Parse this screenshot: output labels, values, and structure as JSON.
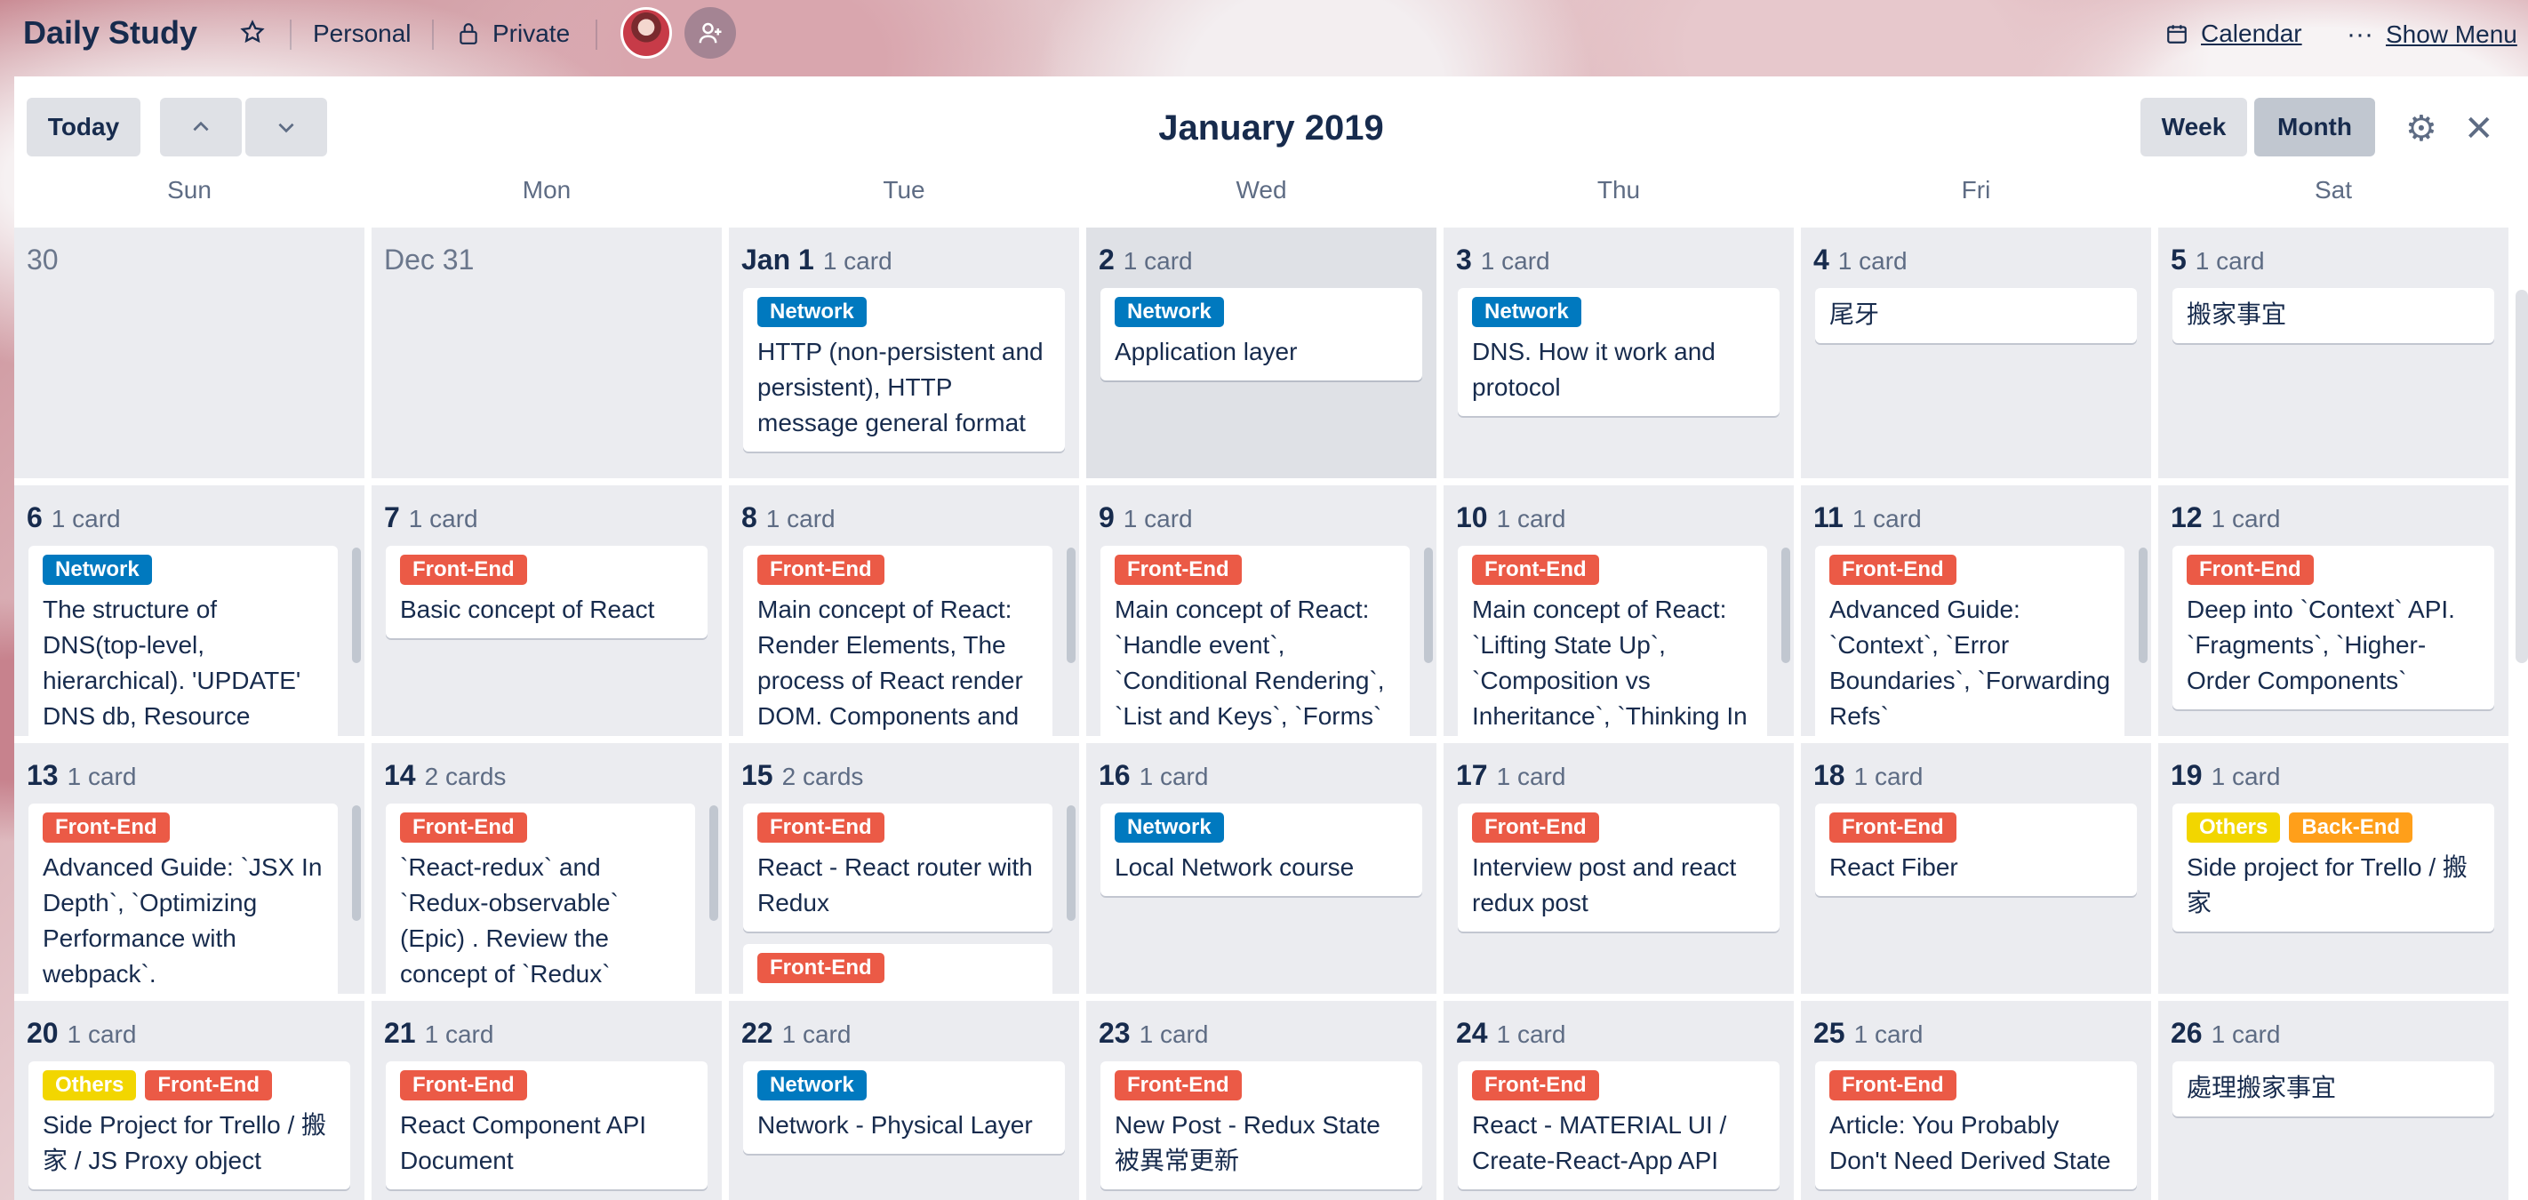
{
  "header": {
    "board_title": "Daily Study",
    "team": "Personal",
    "visibility": "Private",
    "calendar_link": "Calendar",
    "show_menu": "Show Menu"
  },
  "toolbar": {
    "today": "Today",
    "up": "⌃",
    "down": "⌄",
    "month_title": "January 2019",
    "week": "Week",
    "month": "Month",
    "settings": "⚙",
    "close": "✕"
  },
  "weekdays": [
    "Sun",
    "Mon",
    "Tue",
    "Wed",
    "Thu",
    "Fri",
    "Sat"
  ],
  "label_colors": {
    "Network": "#0079bf",
    "Front-End": "#eb5a46",
    "Others": "#f2d600",
    "Back-End": "#ff9f1a"
  },
  "weeks": [
    [
      {
        "num": "30",
        "count": "",
        "dim": true,
        "cards": []
      },
      {
        "num": "Dec 31",
        "count": "",
        "dim": true,
        "cards": []
      },
      {
        "num": "Jan 1",
        "count": "1 card",
        "cards": [
          {
            "labels": [
              "Network"
            ],
            "title": "HTTP (non-persistent and persistent), HTTP message general format"
          }
        ]
      },
      {
        "num": "2",
        "count": "1 card",
        "today": true,
        "cards": [
          {
            "labels": [
              "Network"
            ],
            "title": "Application layer"
          }
        ]
      },
      {
        "num": "3",
        "count": "1 card",
        "cards": [
          {
            "labels": [
              "Network"
            ],
            "title": "DNS. How it work and protocol"
          }
        ]
      },
      {
        "num": "4",
        "count": "1 card",
        "cards": [
          {
            "labels": [],
            "title": "尾牙"
          }
        ]
      },
      {
        "num": "5",
        "count": "1 card",
        "cards": [
          {
            "labels": [],
            "title": "搬家事宜"
          }
        ]
      }
    ],
    [
      {
        "num": "6",
        "count": "1 card",
        "scroll": true,
        "cards": [
          {
            "labels": [
              "Network"
            ],
            "title": "The structure of DNS(top-level, hierarchical). 'UPDATE' DNS db, Resource"
          }
        ]
      },
      {
        "num": "7",
        "count": "1 card",
        "cards": [
          {
            "labels": [
              "Front-End"
            ],
            "title": "Basic concept of React"
          }
        ]
      },
      {
        "num": "8",
        "count": "1 card",
        "scroll": true,
        "cards": [
          {
            "labels": [
              "Front-End"
            ],
            "title": "Main concept of React: Render Elements, The process of React render DOM. Components and"
          }
        ]
      },
      {
        "num": "9",
        "count": "1 card",
        "scroll": true,
        "cards": [
          {
            "labels": [
              "Front-End"
            ],
            "title": "Main concept of React: `Handle event`, `Conditional Rendering`, `List and Keys`, `Forms`"
          }
        ]
      },
      {
        "num": "10",
        "count": "1 card",
        "scroll": true,
        "cards": [
          {
            "labels": [
              "Front-End"
            ],
            "title": "Main concept of React: `Lifting State Up`, `Composition vs Inheritance`, `Thinking In"
          }
        ]
      },
      {
        "num": "11",
        "count": "1 card",
        "scroll": true,
        "cards": [
          {
            "labels": [
              "Front-End"
            ],
            "title": "Advanced Guide: `Context`, `Error Boundaries`, `Forwarding Refs`"
          }
        ]
      },
      {
        "num": "12",
        "count": "1 card",
        "cards": [
          {
            "labels": [
              "Front-End"
            ],
            "title": "Deep into `Context` API. `Fragments`, `Higher-Order Components`"
          }
        ]
      }
    ],
    [
      {
        "num": "13",
        "count": "1 card",
        "scroll": true,
        "cards": [
          {
            "labels": [
              "Front-End"
            ],
            "title": "Advanced Guide: `JSX In Depth`, `Optimizing Performance with webpack`."
          }
        ]
      },
      {
        "num": "14",
        "count": "2 cards",
        "scroll": true,
        "cards": [
          {
            "labels": [
              "Front-End"
            ],
            "title": "`React-redux` and `Redux-observable` (Epic) . Review the concept of `Redux`"
          }
        ]
      },
      {
        "num": "15",
        "count": "2 cards",
        "scroll": true,
        "cards": [
          {
            "labels": [
              "Front-End"
            ],
            "title": "React - React router with Redux"
          },
          {
            "labels": [
              "Front-End"
            ],
            "title": ""
          }
        ]
      },
      {
        "num": "16",
        "count": "1 card",
        "cards": [
          {
            "labels": [
              "Network"
            ],
            "title": "Local Network course"
          }
        ]
      },
      {
        "num": "17",
        "count": "1 card",
        "cards": [
          {
            "labels": [
              "Front-End"
            ],
            "title": "Interview post and react redux post"
          }
        ]
      },
      {
        "num": "18",
        "count": "1 card",
        "cards": [
          {
            "labels": [
              "Front-End"
            ],
            "title": "React Fiber"
          }
        ]
      },
      {
        "num": "19",
        "count": "1 card",
        "cards": [
          {
            "labels": [
              "Others",
              "Back-End"
            ],
            "title": "Side project for Trello / 搬家"
          }
        ]
      }
    ],
    [
      {
        "num": "20",
        "count": "1 card",
        "cards": [
          {
            "labels": [
              "Others",
              "Front-End"
            ],
            "title": "Side Project for Trello / 搬家 / JS Proxy object"
          }
        ]
      },
      {
        "num": "21",
        "count": "1 card",
        "cards": [
          {
            "labels": [
              "Front-End"
            ],
            "title": "React Component API Document"
          }
        ]
      },
      {
        "num": "22",
        "count": "1 card",
        "cards": [
          {
            "labels": [
              "Network"
            ],
            "title": "Network - Physical Layer"
          }
        ]
      },
      {
        "num": "23",
        "count": "1 card",
        "cards": [
          {
            "labels": [
              "Front-End"
            ],
            "title": "New Post - Redux State 被異常更新"
          }
        ]
      },
      {
        "num": "24",
        "count": "1 card",
        "cards": [
          {
            "labels": [
              "Front-End"
            ],
            "title": "React - MATERIAL UI / Create-React-App API"
          }
        ]
      },
      {
        "num": "25",
        "count": "1 card",
        "cards": [
          {
            "labels": [
              "Front-End"
            ],
            "title": "Article: You Probably Don't Need Derived State"
          }
        ]
      },
      {
        "num": "26",
        "count": "1 card",
        "cards": [
          {
            "labels": [],
            "title": "處理搬家事宜"
          }
        ]
      }
    ]
  ]
}
